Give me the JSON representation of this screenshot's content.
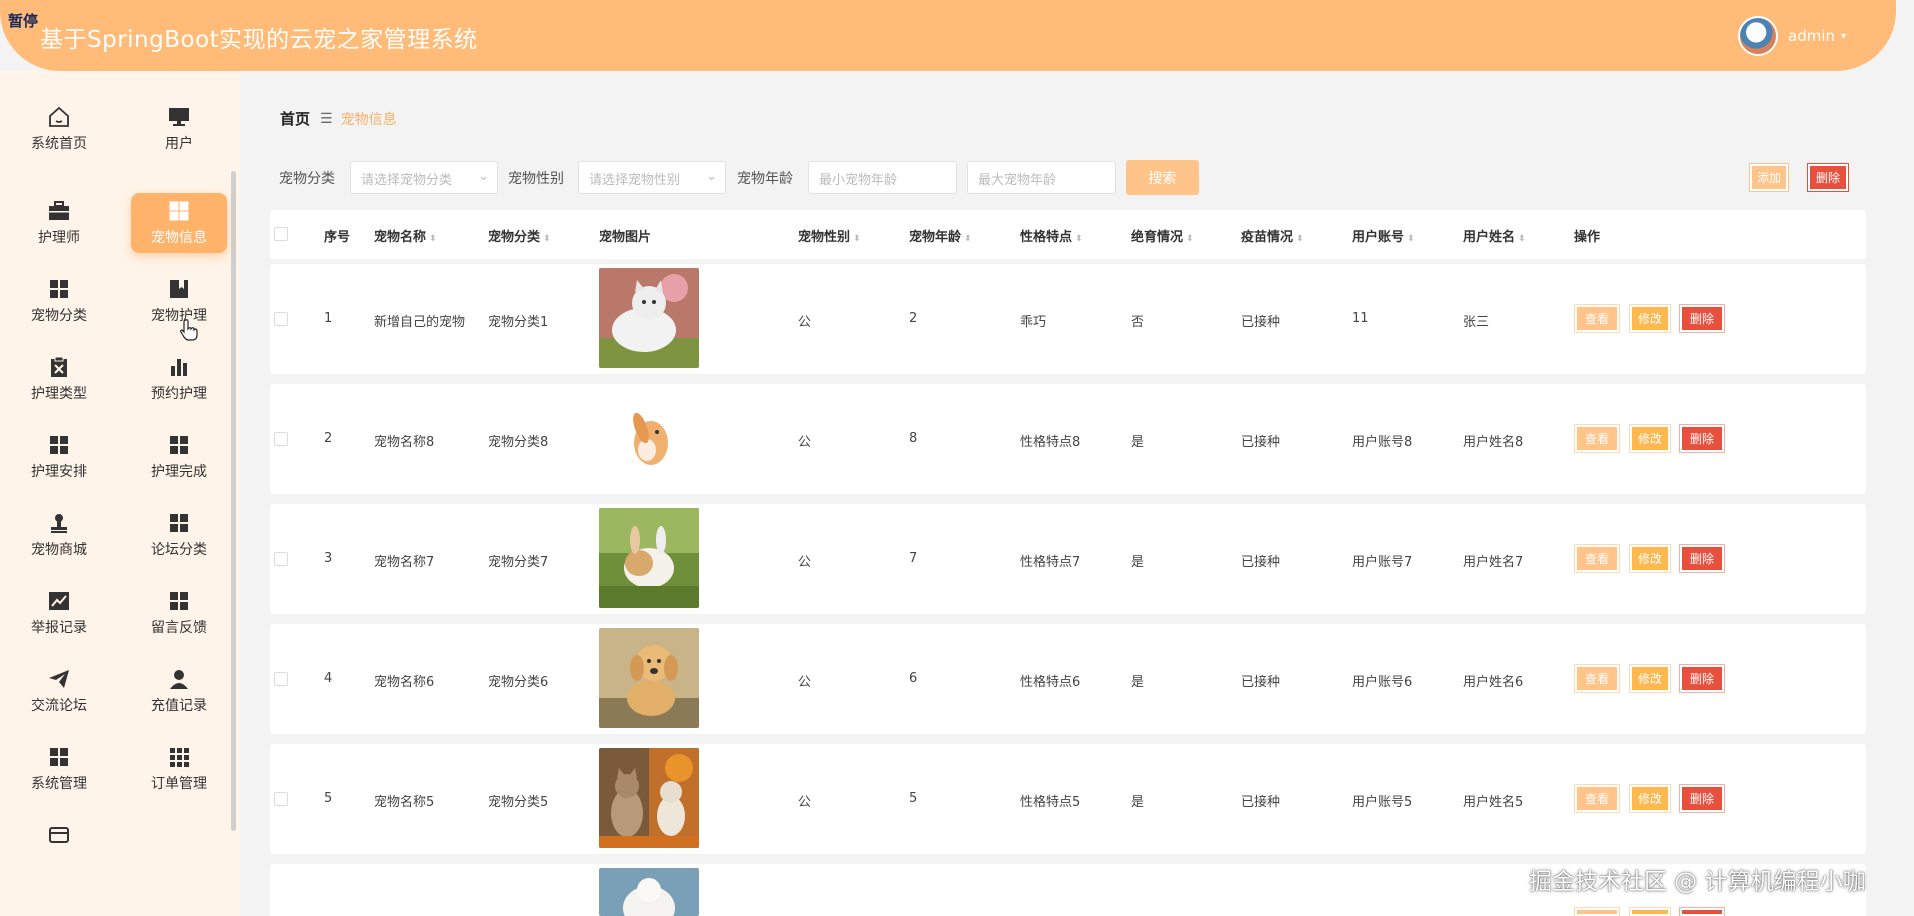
{
  "header": {
    "overlay_tag": "暂停",
    "title": "基于SpringBoot实现的云宠之家管理系统",
    "user": {
      "name": "admin",
      "caret": "▾"
    }
  },
  "sidebar": {
    "items": [
      {
        "label": "系统首页",
        "icon": "home-icon"
      },
      {
        "label": "用户",
        "icon": "monitor-icon"
      },
      {
        "label": "护理师",
        "icon": "briefcase-icon"
      },
      {
        "label": "宠物信息",
        "icon": "grid-icon",
        "active": true
      },
      {
        "label": "宠物分类",
        "icon": "grid-icon"
      },
      {
        "label": "宠物护理",
        "icon": "book-icon"
      },
      {
        "label": "护理类型",
        "icon": "clipboard-icon"
      },
      {
        "label": "预约护理",
        "icon": "bar-chart-icon"
      },
      {
        "label": "护理安排",
        "icon": "grid-icon"
      },
      {
        "label": "护理完成",
        "icon": "grid-icon"
      },
      {
        "label": "宠物商城",
        "icon": "stamp-icon"
      },
      {
        "label": "论坛分类",
        "icon": "grid-icon"
      },
      {
        "label": "举报记录",
        "icon": "line-chart-icon"
      },
      {
        "label": "留言反馈",
        "icon": "grid-icon"
      },
      {
        "label": "交流论坛",
        "icon": "send-icon"
      },
      {
        "label": "充值记录",
        "icon": "person-icon"
      },
      {
        "label": "系统管理",
        "icon": "grid-icon"
      },
      {
        "label": "订单管理",
        "icon": "grid-9-icon"
      },
      {
        "label": "",
        "icon": "wallet-icon"
      }
    ]
  },
  "breadcrumb": {
    "home": "首页",
    "separator": "☰",
    "current": "宠物信息"
  },
  "filters": {
    "category_label": "宠物分类",
    "category_placeholder": "请选择宠物分类",
    "gender_label": "宠物性别",
    "gender_placeholder": "请选择宠物性别",
    "age_label": "宠物年龄",
    "age_min_placeholder": "最小宠物年龄",
    "age_max_placeholder": "最大宠物年龄",
    "search_button": "搜索",
    "add_button": "添加",
    "delete_button": "删除"
  },
  "table": {
    "columns": [
      "序号",
      "宠物名称",
      "宠物分类",
      "宠物图片",
      "宠物性别",
      "宠物年龄",
      "性格特点",
      "绝育情况",
      "疫苗情况",
      "用户账号",
      "用户姓名",
      "操作"
    ],
    "actions": {
      "view": "查看",
      "edit": "修改",
      "delete": "删除"
    },
    "rows": [
      {
        "index": "1",
        "name": "新增自己的宠物",
        "category": "宠物分类1",
        "image": "cat-image",
        "gender": "公",
        "age": "2",
        "personality": "乖巧",
        "neutered": "否",
        "vaccine": "已接种",
        "account": "11",
        "username": "张三"
      },
      {
        "index": "2",
        "name": "宠物名称8",
        "category": "宠物分类8",
        "image": "rabbit-image",
        "gender": "公",
        "age": "8",
        "personality": "性格特点8",
        "neutered": "是",
        "vaccine": "已接种",
        "account": "用户账号8",
        "username": "用户姓名8"
      },
      {
        "index": "3",
        "name": "宠物名称7",
        "category": "宠物分类7",
        "image": "rabbit-grass-image",
        "gender": "公",
        "age": "7",
        "personality": "性格特点7",
        "neutered": "是",
        "vaccine": "已接种",
        "account": "用户账号7",
        "username": "用户姓名7"
      },
      {
        "index": "4",
        "name": "宠物名称6",
        "category": "宠物分类6",
        "image": "puppy-image",
        "gender": "公",
        "age": "6",
        "personality": "性格特点6",
        "neutered": "是",
        "vaccine": "已接种",
        "account": "用户账号6",
        "username": "用户姓名6"
      },
      {
        "index": "5",
        "name": "宠物名称5",
        "category": "宠物分类5",
        "image": "kittens-image",
        "gender": "公",
        "age": "5",
        "personality": "性格特点5",
        "neutered": "是",
        "vaccine": "已接种",
        "account": "用户账号5",
        "username": "用户姓名5"
      }
    ]
  },
  "watermark": "掘金技术社区 @ 计算机编程小咖",
  "colors": {
    "header": "#ffbb77",
    "accent": "#ffb36a",
    "danger": "#e8503e",
    "sidebar_bg": "#fff4ea"
  }
}
